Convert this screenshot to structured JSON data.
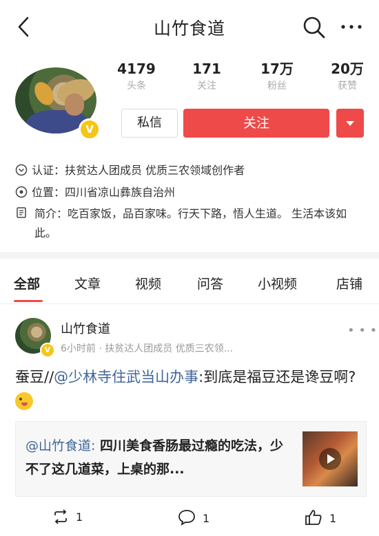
{
  "header": {
    "title": "山竹食道"
  },
  "profile": {
    "stats": [
      {
        "value": "4179",
        "label": "头条"
      },
      {
        "value": "171",
        "label": "关注"
      },
      {
        "value": "17万",
        "label": "粉丝"
      },
      {
        "value": "20万",
        "label": "获赞"
      }
    ],
    "message_label": "私信",
    "follow_label": "关注",
    "badge": "V",
    "verification": "认证：扶贫达人团成员 优质三农领域创作者",
    "location": "位置：四川省凉山彝族自治州",
    "bio": "简介：吃百家饭，品百家味。行天下路，悟人生道。 生活本该如此。"
  },
  "tabs": [
    "全部",
    "文章",
    "视频",
    "问答",
    "小视频",
    "店铺"
  ],
  "post": {
    "author": "山竹食道",
    "meta": "6小时前 · 扶贫达人团成员 优质三农领...",
    "text_prefix": "蚕豆//",
    "mention": "@少林寺住武当山办事",
    "text_suffix": ":到底是福豆还是谗豆啊?",
    "shared": {
      "mention": "@山竹食道:",
      "text": " 四川美食香肠最过瘾的吃法，少不了这几道菜，上桌的那..."
    },
    "actions": {
      "repost_count": "1",
      "comment_count": "1",
      "like_count": "1"
    }
  },
  "colors": {
    "accent": "#ee4a4a",
    "mention": "#406599",
    "badge": "#f5c518"
  }
}
